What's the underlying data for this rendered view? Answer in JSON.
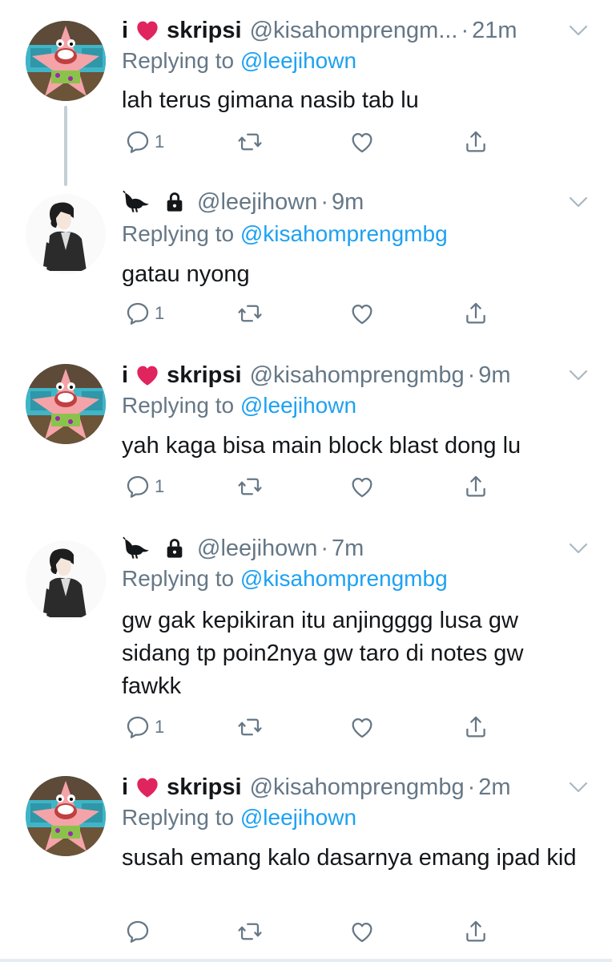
{
  "tweets": [
    {
      "avatar": "patrick-star-avatar",
      "name_prefix": "i",
      "name_suffix": "skripsi",
      "handle": "@kisahomprengm...",
      "time": "21m",
      "replying_label": "Replying to",
      "replying_to": "@leejihown",
      "text": "lah terus gimana nasib tab lu",
      "reply_count": "1"
    },
    {
      "avatar": "anime-man-avatar",
      "handle": "@leejihown",
      "time": "9m",
      "replying_label": "Replying to",
      "replying_to": "@kisahomprengmbg",
      "text": "gatau nyong",
      "reply_count": "1"
    },
    {
      "avatar": "patrick-star-avatar",
      "name_prefix": "i",
      "name_suffix": "skripsi",
      "handle": "@kisahomprengmbg",
      "time": "9m",
      "replying_label": "Replying to",
      "replying_to": "@leejihown",
      "text": "yah kaga bisa main block blast dong lu",
      "reply_count": "1"
    },
    {
      "avatar": "anime-man-avatar",
      "handle": "@leejihown",
      "time": "7m",
      "replying_label": "Replying to",
      "replying_to": "@kisahomprengmbg",
      "text": "gw gak kepikiran itu anjingggg lusa gw sidang tp poin2nya gw taro di notes gw fawkk",
      "reply_count": "1"
    },
    {
      "avatar": "patrick-star-avatar",
      "name_prefix": "i",
      "name_suffix": "skripsi",
      "handle": "@kisahomprengmbg",
      "time": "2m",
      "replying_label": "Replying to",
      "replying_to": "@leejihown",
      "text": "susah emang kalo dasarnya emang ipad kid",
      "reply_count": ""
    }
  ],
  "separator": "·",
  "colors": {
    "text": "#14171a",
    "secondary": "#657786",
    "link": "#1da1f2",
    "thread_line": "#c4cfd6",
    "heart": "#e0245e"
  }
}
